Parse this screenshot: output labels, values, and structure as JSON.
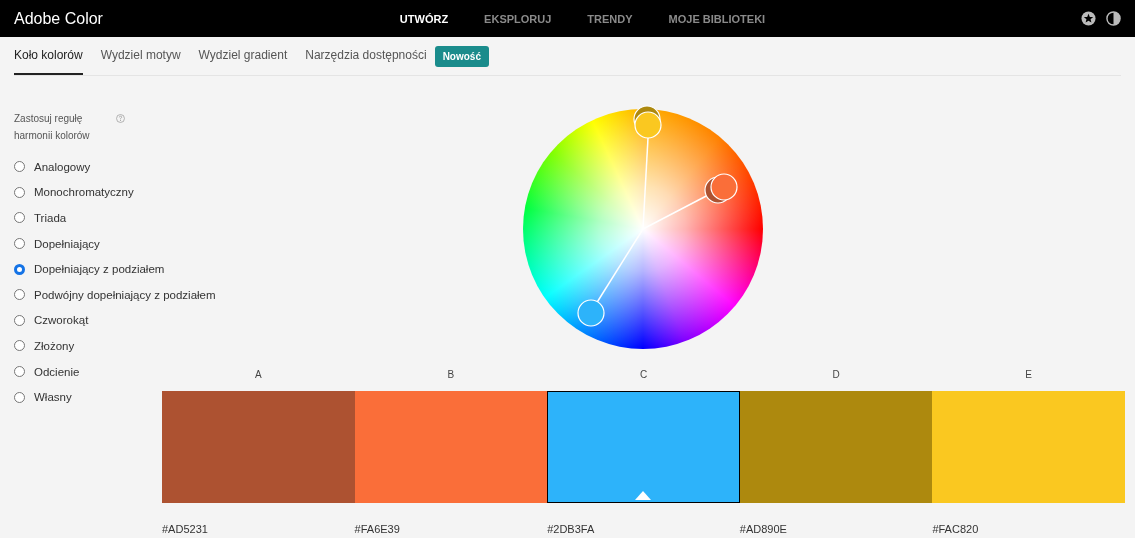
{
  "app": {
    "title": "Adobe Color"
  },
  "nav": [
    {
      "label": "UTWÓRZ",
      "selected": true
    },
    {
      "label": "EKSPLORUJ",
      "selected": false
    },
    {
      "label": "TRENDY",
      "selected": false
    },
    {
      "label": "MOJE BIBLIOTEKI",
      "selected": false
    }
  ],
  "tabs": [
    {
      "label": "Koło kolorów",
      "selected": true
    },
    {
      "label": "Wydziel motyw",
      "selected": false
    },
    {
      "label": "Wydziel gradient",
      "selected": false
    },
    {
      "label": "Narzędzia dostępności",
      "selected": false
    }
  ],
  "new_badge": "Nowość",
  "harmony": {
    "title": "Zastosuj regułę harmonii kolorów",
    "options": [
      {
        "label": "Analogowy",
        "selected": false
      },
      {
        "label": "Monochromatyczny",
        "selected": false
      },
      {
        "label": "Triada",
        "selected": false
      },
      {
        "label": "Dopełniający",
        "selected": false
      },
      {
        "label": "Dopełniający z podziałem",
        "selected": true
      },
      {
        "label": "Podwójny dopełniający z podziałem",
        "selected": false
      },
      {
        "label": "Czworokąt",
        "selected": false
      },
      {
        "label": "Złożony",
        "selected": false
      },
      {
        "label": "Odcienie",
        "selected": false
      },
      {
        "label": "Własny",
        "selected": false
      }
    ]
  },
  "swatches": [
    {
      "letter": "A",
      "color": "#ad5231",
      "hex": "#AD5231",
      "selected": false
    },
    {
      "letter": "B",
      "color": "#fa6e39",
      "hex": "#FA6E39",
      "selected": false
    },
    {
      "letter": "C",
      "color": "#2db3fa",
      "hex": "#2DB3FA",
      "selected": true
    },
    {
      "letter": "D",
      "color": "#ad890e",
      "hex": "#AD890E",
      "selected": false
    },
    {
      "letter": "E",
      "color": "#fac820",
      "hex": "#FAC820",
      "selected": false
    }
  ]
}
